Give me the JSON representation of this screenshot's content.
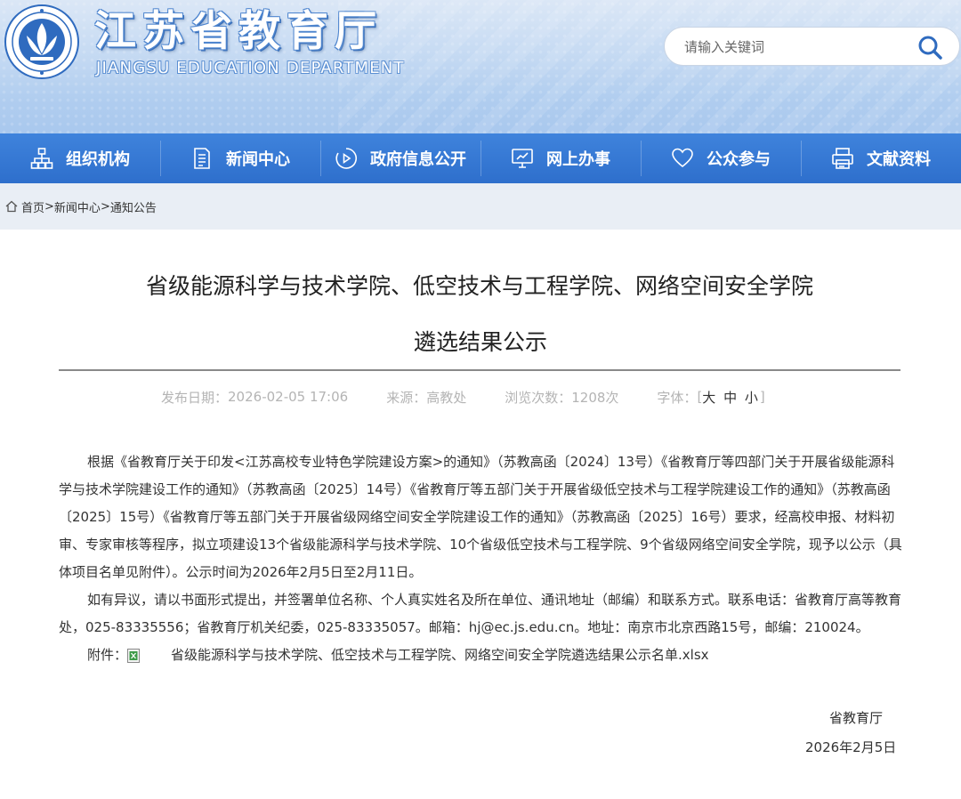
{
  "header": {
    "title_cn": "江苏省教育厅",
    "title_en": "JIANGSU EDUCATION DEPARTMENT",
    "search_placeholder": "请输入关键词"
  },
  "nav": [
    {
      "label": "组织机构",
      "icon": "org-chart-icon"
    },
    {
      "label": "新闻中心",
      "icon": "document-icon"
    },
    {
      "label": "政府信息公开",
      "icon": "play-circle-icon"
    },
    {
      "label": "网上办事",
      "icon": "monitor-icon"
    },
    {
      "label": "公众参与",
      "icon": "heart-icon"
    },
    {
      "label": "文献资料",
      "icon": "printer-icon"
    }
  ],
  "breadcrumb": {
    "home": "首页",
    "news": "新闻中心",
    "notice": "通知公告",
    "separator": ">"
  },
  "article": {
    "title_line1": "省级能源科学与技术学院、低空技术与工程学院、网络空间安全学院",
    "title_line2": "遴选结果公示",
    "meta": {
      "date_label": "发布日期：",
      "date": "2026-02-05 17:06",
      "source_label": "来源：",
      "source": "高教处",
      "views_label": "浏览次数：",
      "views": "1208次",
      "font_label": "字体：",
      "font_bracket_open": "[",
      "font_sizes": "大 中 小",
      "font_bracket_close": "]"
    },
    "paragraph1": "根据《省教育厅关于印发<江苏高校专业特色学院建设方案>的通知》（苏教高函〔2024〕13号）《省教育厅等四部门关于开展省级能源科学与技术学院建设工作的通知》（苏教高函〔2025〕14号）《省教育厅等五部门关于开展省级低空技术与工程学院建设工作的通知》（苏教高函〔2025〕15号）《省教育厅等五部门关于开展省级网络空间安全学院建设工作的通知》（苏教高函〔2025〕16号）要求，经高校申报、材料初审、专家审核等程序，拟立项建设13个省级能源科学与技术学院、10个省级低空技术与工程学院、9个省级网络空间安全学院，现予以公示（具体项目名单见附件）。公示时间为2026年2月5日至2月11日。",
    "paragraph2": "如有异议，请以书面形式提出，并签署单位名称、个人真实姓名及所在单位、通讯地址（邮编）和联系方式。联系电话：省教育厅高等教育处，025-83335556；省教育厅机关纪委，025-83335057。邮箱：hj@ec.js.edu.cn。地址：南京市北京西路15号，邮编：210024。",
    "attachment_label": "附件：",
    "attachment_name": "省级能源科学与技术学院、低空技术与工程学院、网络空间安全学院遴选结果公示名单.xlsx",
    "signature_org": "省教育厅",
    "signature_date": "2026年2月5日"
  },
  "colors": {
    "nav_bg": "#2e6fcc",
    "header_bg": "#b0cdef",
    "title_stroke": "#4f86cf"
  }
}
